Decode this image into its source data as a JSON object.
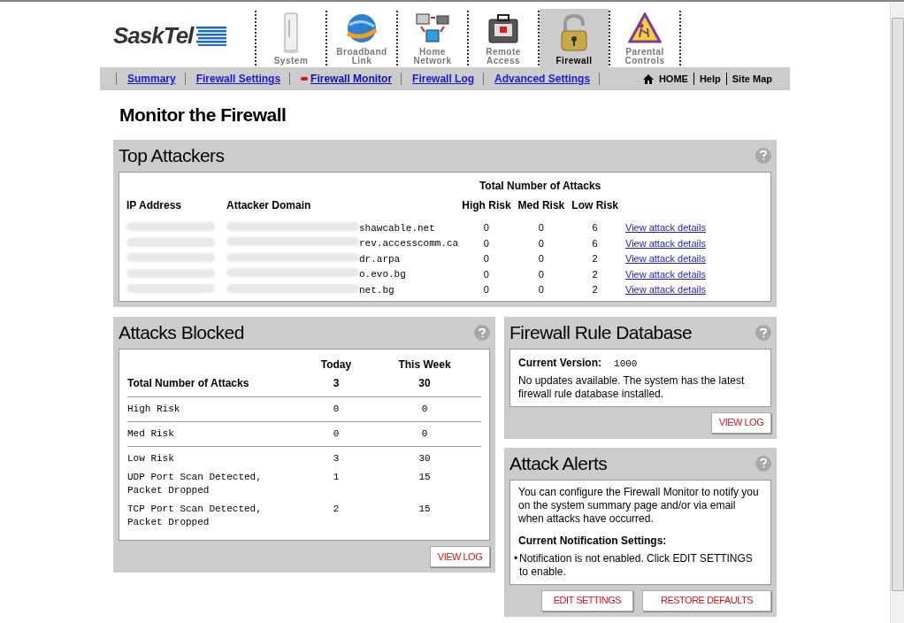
{
  "logo": {
    "text": "SaskTel"
  },
  "tabs": [
    {
      "label": "System",
      "selected": false
    },
    {
      "label": "Broadband Link",
      "selected": false
    },
    {
      "label": "Home Network",
      "selected": false
    },
    {
      "label": "Remote Access",
      "selected": false
    },
    {
      "label": "Firewall",
      "selected": true
    },
    {
      "label": "Parental Controls",
      "selected": false
    }
  ],
  "subnav": [
    {
      "label": "Summary",
      "selected": false
    },
    {
      "label": "Firewall Settings",
      "selected": false
    },
    {
      "label": "Firewall Monitor",
      "selected": true
    },
    {
      "label": "Firewall Log",
      "selected": false
    },
    {
      "label": "Advanced Settings",
      "selected": false
    }
  ],
  "utility_links": [
    "HOME",
    "Help",
    "Site Map"
  ],
  "page_title": "Monitor the Firewall",
  "top_attackers": {
    "title": "Top Attackers",
    "group_heading": "Total Number of Attacks",
    "columns": [
      "IP Address",
      "Attacker Domain",
      "High Risk",
      "Med Risk",
      "Low Risk"
    ],
    "rows": [
      {
        "domain": "shawcable.net",
        "high": "0",
        "med": "0",
        "low": "6",
        "link": "View attack details"
      },
      {
        "domain": "rev.accesscomm.ca",
        "high": "0",
        "med": "0",
        "low": "6",
        "link": "View attack details"
      },
      {
        "domain": "dr.arpa",
        "high": "0",
        "med": "0",
        "low": "2",
        "link": "View attack details"
      },
      {
        "domain": "o.evo.bg",
        "high": "0",
        "med": "0",
        "low": "2",
        "link": "View attack details"
      },
      {
        "domain": "net.bg",
        "high": "0",
        "med": "0",
        "low": "2",
        "link": "View attack details"
      }
    ]
  },
  "attacks_blocked": {
    "title": "Attacks Blocked",
    "columns": [
      "Today",
      "This Week"
    ],
    "total": {
      "label": "Total Number of Attacks",
      "today": "3",
      "week": "30"
    },
    "rows": [
      {
        "label": "High Risk",
        "today": "0",
        "week": "0",
        "divider": true
      },
      {
        "label": "Med Risk",
        "today": "0",
        "week": "0",
        "divider": true
      },
      {
        "label": "Low Risk",
        "today": "3",
        "week": "30",
        "divider": false
      },
      {
        "label": "UDP Port Scan Detected, Packet Dropped",
        "today": "1",
        "week": "15",
        "divider": false
      },
      {
        "label": "TCP Port Scan Detected, Packet Dropped",
        "today": "2",
        "week": "15",
        "divider": false
      }
    ],
    "button": "VIEW LOG"
  },
  "rule_database": {
    "title": "Firewall Rule Database",
    "version_label": "Current Version:",
    "version": "1000",
    "message": "No updates available. The system has the latest firewall rule database installed.",
    "button": "VIEW LOG"
  },
  "attack_alerts": {
    "title": "Attack Alerts",
    "description": "You can configure the Firewall Monitor to notify you on the system summary page and/or via email when attacks have occurred.",
    "settings_heading": "Current Notification Settings:",
    "bullet": "•",
    "setting": "Notification is not enabled. Click EDIT SETTINGS to enable.",
    "buttons": [
      "EDIT SETTINGS",
      "RESTORE DEFAULTS"
    ]
  }
}
